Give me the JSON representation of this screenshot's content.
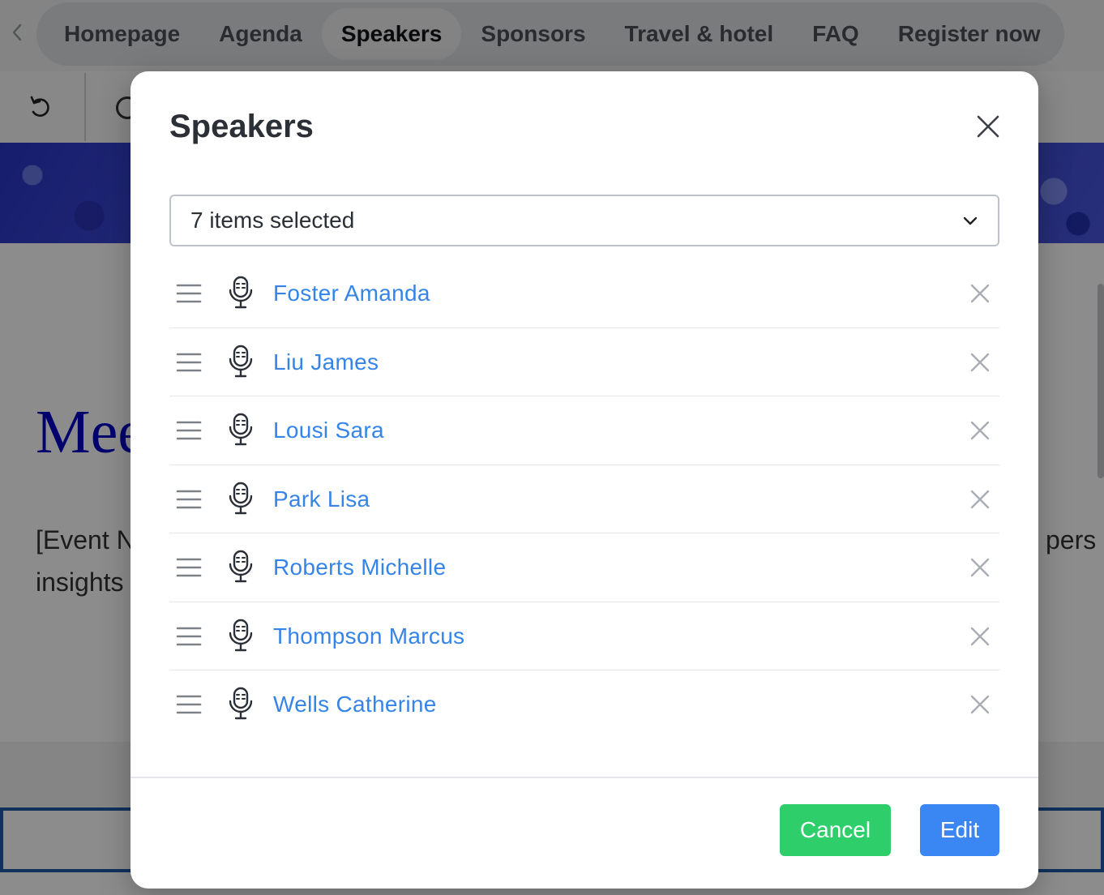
{
  "nav": {
    "items": [
      {
        "label": "Homepage",
        "active": false
      },
      {
        "label": "Agenda",
        "active": false
      },
      {
        "label": "Speakers",
        "active": true
      },
      {
        "label": "Sponsors",
        "active": false
      },
      {
        "label": "Travel & hotel",
        "active": false
      },
      {
        "label": "FAQ",
        "active": false
      },
      {
        "label": "Register now",
        "active": false
      }
    ]
  },
  "page": {
    "heading_partial": "Mee",
    "para_line1_partial": "[Event N",
    "para_line2_partial": "insights",
    "para_right_partial": "pers"
  },
  "modal": {
    "title": "Speakers",
    "select_value": "7 items selected",
    "speakers": [
      {
        "name": "Foster Amanda"
      },
      {
        "name": "Liu James"
      },
      {
        "name": "Lousi Sara"
      },
      {
        "name": "Park Lisa"
      },
      {
        "name": "Roberts Michelle"
      },
      {
        "name": "Thompson Marcus"
      },
      {
        "name": "Wells Catherine"
      }
    ],
    "cancel_label": "Cancel",
    "edit_label": "Edit"
  },
  "colors": {
    "link": "#3584e8",
    "cancel_bg": "#2ecf6b",
    "edit_bg": "#3a86f2",
    "heading_blue": "#0000c8"
  },
  "icons": [
    "back-arrow-icon",
    "undo-icon",
    "close-icon",
    "chevron-down-icon",
    "drag-handle-icon",
    "microphone-icon",
    "remove-icon"
  ]
}
